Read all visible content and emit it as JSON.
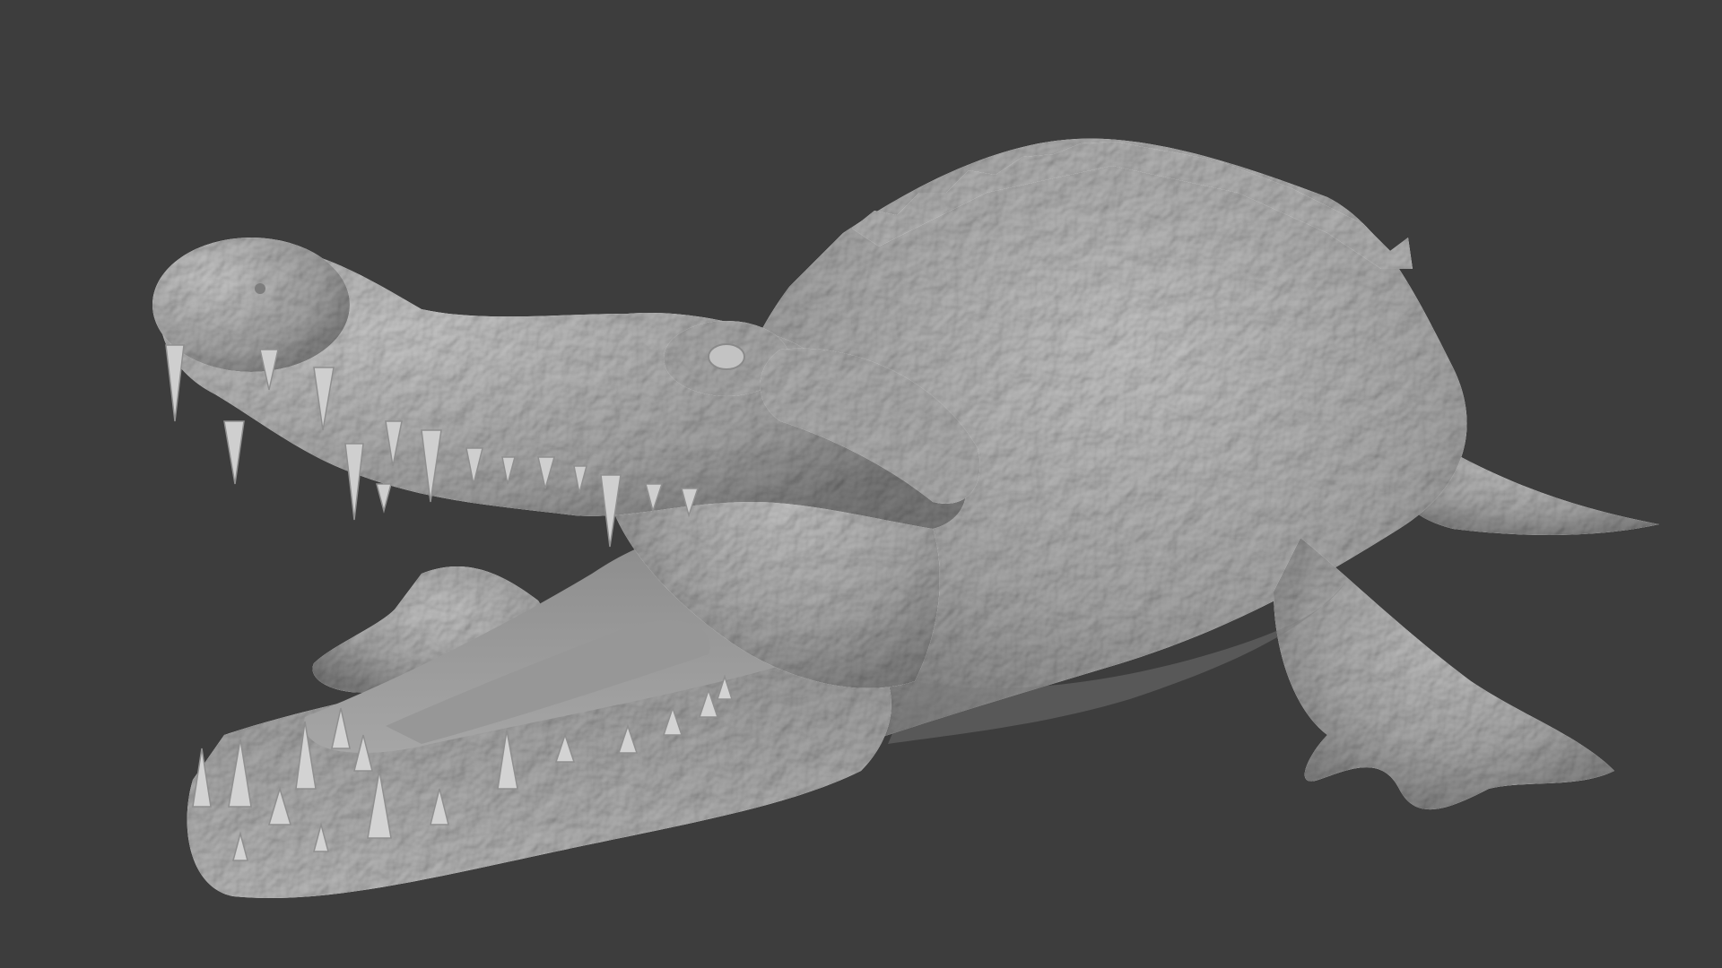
{
  "viewport": {
    "background": "#3d3d3d",
    "subject": "crocodile-sculpt",
    "mesh_color": "#a4a4a4",
    "mesh_highlight": "#c9c9c9",
    "mesh_shadow": "#6f6f6f",
    "mouth_interior": "#8a8a8a",
    "teeth_color": "#d2d2d2"
  }
}
